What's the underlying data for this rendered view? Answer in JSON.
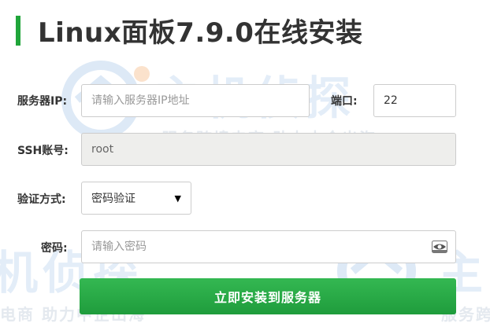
{
  "header": {
    "title": "Linux面板7.9.0在线安装",
    "accent_color": "#20a53a"
  },
  "watermark": {
    "main_text": "主机侦探",
    "sub_text": "服务跨境电商 助力中企出海",
    "bottom_sub_text_left": "电商 助力中企出海",
    "bottom_sub_text_right": "服务跨",
    "bottom_main_left": "机侦探",
    "bottom_main_right": "主"
  },
  "form": {
    "server_ip": {
      "label": "服务器IP:",
      "placeholder": "请输入服务器IP地址",
      "value": ""
    },
    "port": {
      "label": "端口:",
      "value": "22"
    },
    "ssh_account": {
      "label": "SSH账号:",
      "value": "root"
    },
    "auth_method": {
      "label": "验证方式:",
      "selected": "密码验证",
      "caret": "▼"
    },
    "password": {
      "label": "密码:",
      "placeholder": "请输入密码",
      "value": ""
    }
  },
  "actions": {
    "submit_label": "立即安装到服务器",
    "submit_color": "#20a53a"
  },
  "icons": {
    "watermark_logo": "globe-wrench-icon",
    "show_password": "eye-icon"
  }
}
